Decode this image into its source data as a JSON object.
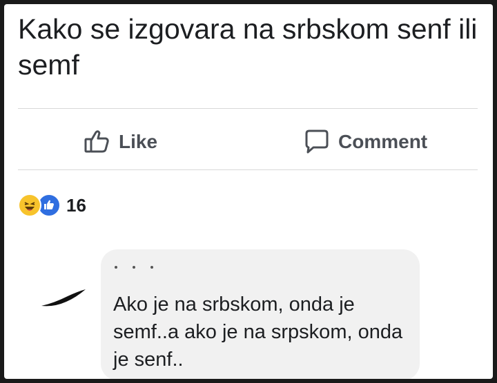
{
  "post": {
    "text": "Kako se izgovara na srbskom senf ili semf"
  },
  "actions": {
    "like_label": "Like",
    "comment_label": "Comment"
  },
  "reactions": {
    "icons": [
      "haha-emoji-icon",
      "like-reaction-icon"
    ],
    "count": "16"
  },
  "comment": {
    "text": "Ako je na srbskom, onda je semf..a ako je na srpskom, onda je senf.."
  },
  "colors": {
    "like_blue": "#2f6ee0",
    "haha_yellow": "#f7c32c",
    "bubble_bg": "#f1f1f1"
  }
}
